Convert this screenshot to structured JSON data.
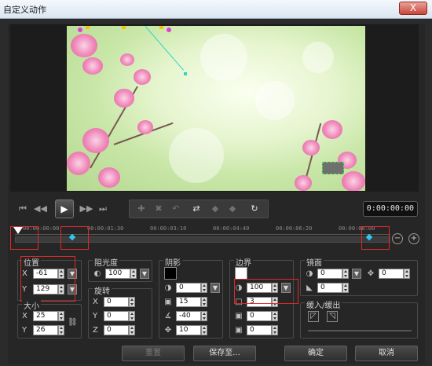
{
  "window": {
    "title": "自定义动作",
    "close": "X"
  },
  "timecode": "0:00:00:00",
  "timeline": {
    "ticks": [
      "00:00:00:00",
      "00:00:01:30",
      "00:00:03:10",
      "00:00:04:40",
      "00:00:06:20",
      "00:00:08:00"
    ]
  },
  "transport": {
    "icons": [
      "go-start-icon",
      "prev-frame-icon",
      "play-icon",
      "next-frame-icon",
      "go-end-icon"
    ],
    "tools": [
      "add-keyframe-icon",
      "remove-keyframe-icon",
      "reverse-icon",
      "swap-icon",
      "prev-keyframe-icon",
      "next-keyframe-icon",
      "loop-icon"
    ]
  },
  "position": {
    "title": "位置",
    "x_label": "X",
    "x_value": "-61",
    "y_label": "Y",
    "y_value": "129"
  },
  "size": {
    "title": "大小",
    "x_label": "X",
    "x_value": "25",
    "y_label": "Y",
    "y_value": "26"
  },
  "opacity": {
    "title": "阻光度",
    "value": "100"
  },
  "rotation": {
    "title": "旋转",
    "x_label": "X",
    "x_value": "0",
    "y_label": "Y",
    "y_value": "0",
    "z_label": "Z",
    "z_value": "0"
  },
  "shadow": {
    "title": "阴影",
    "color": "#000000",
    "values": [
      "0",
      "15",
      "-40",
      "10"
    ]
  },
  "border": {
    "title": "边界",
    "color": "#ffffff",
    "values": [
      "100",
      "3",
      "0",
      "0"
    ]
  },
  "mirror": {
    "title": "镜面",
    "values": [
      "0",
      "0"
    ],
    "offset": "0"
  },
  "ease": {
    "title": "缓入/缓出"
  },
  "footer": {
    "reset": "重置",
    "save_to": "保存至...",
    "ok": "确定",
    "cancel": "取消"
  }
}
